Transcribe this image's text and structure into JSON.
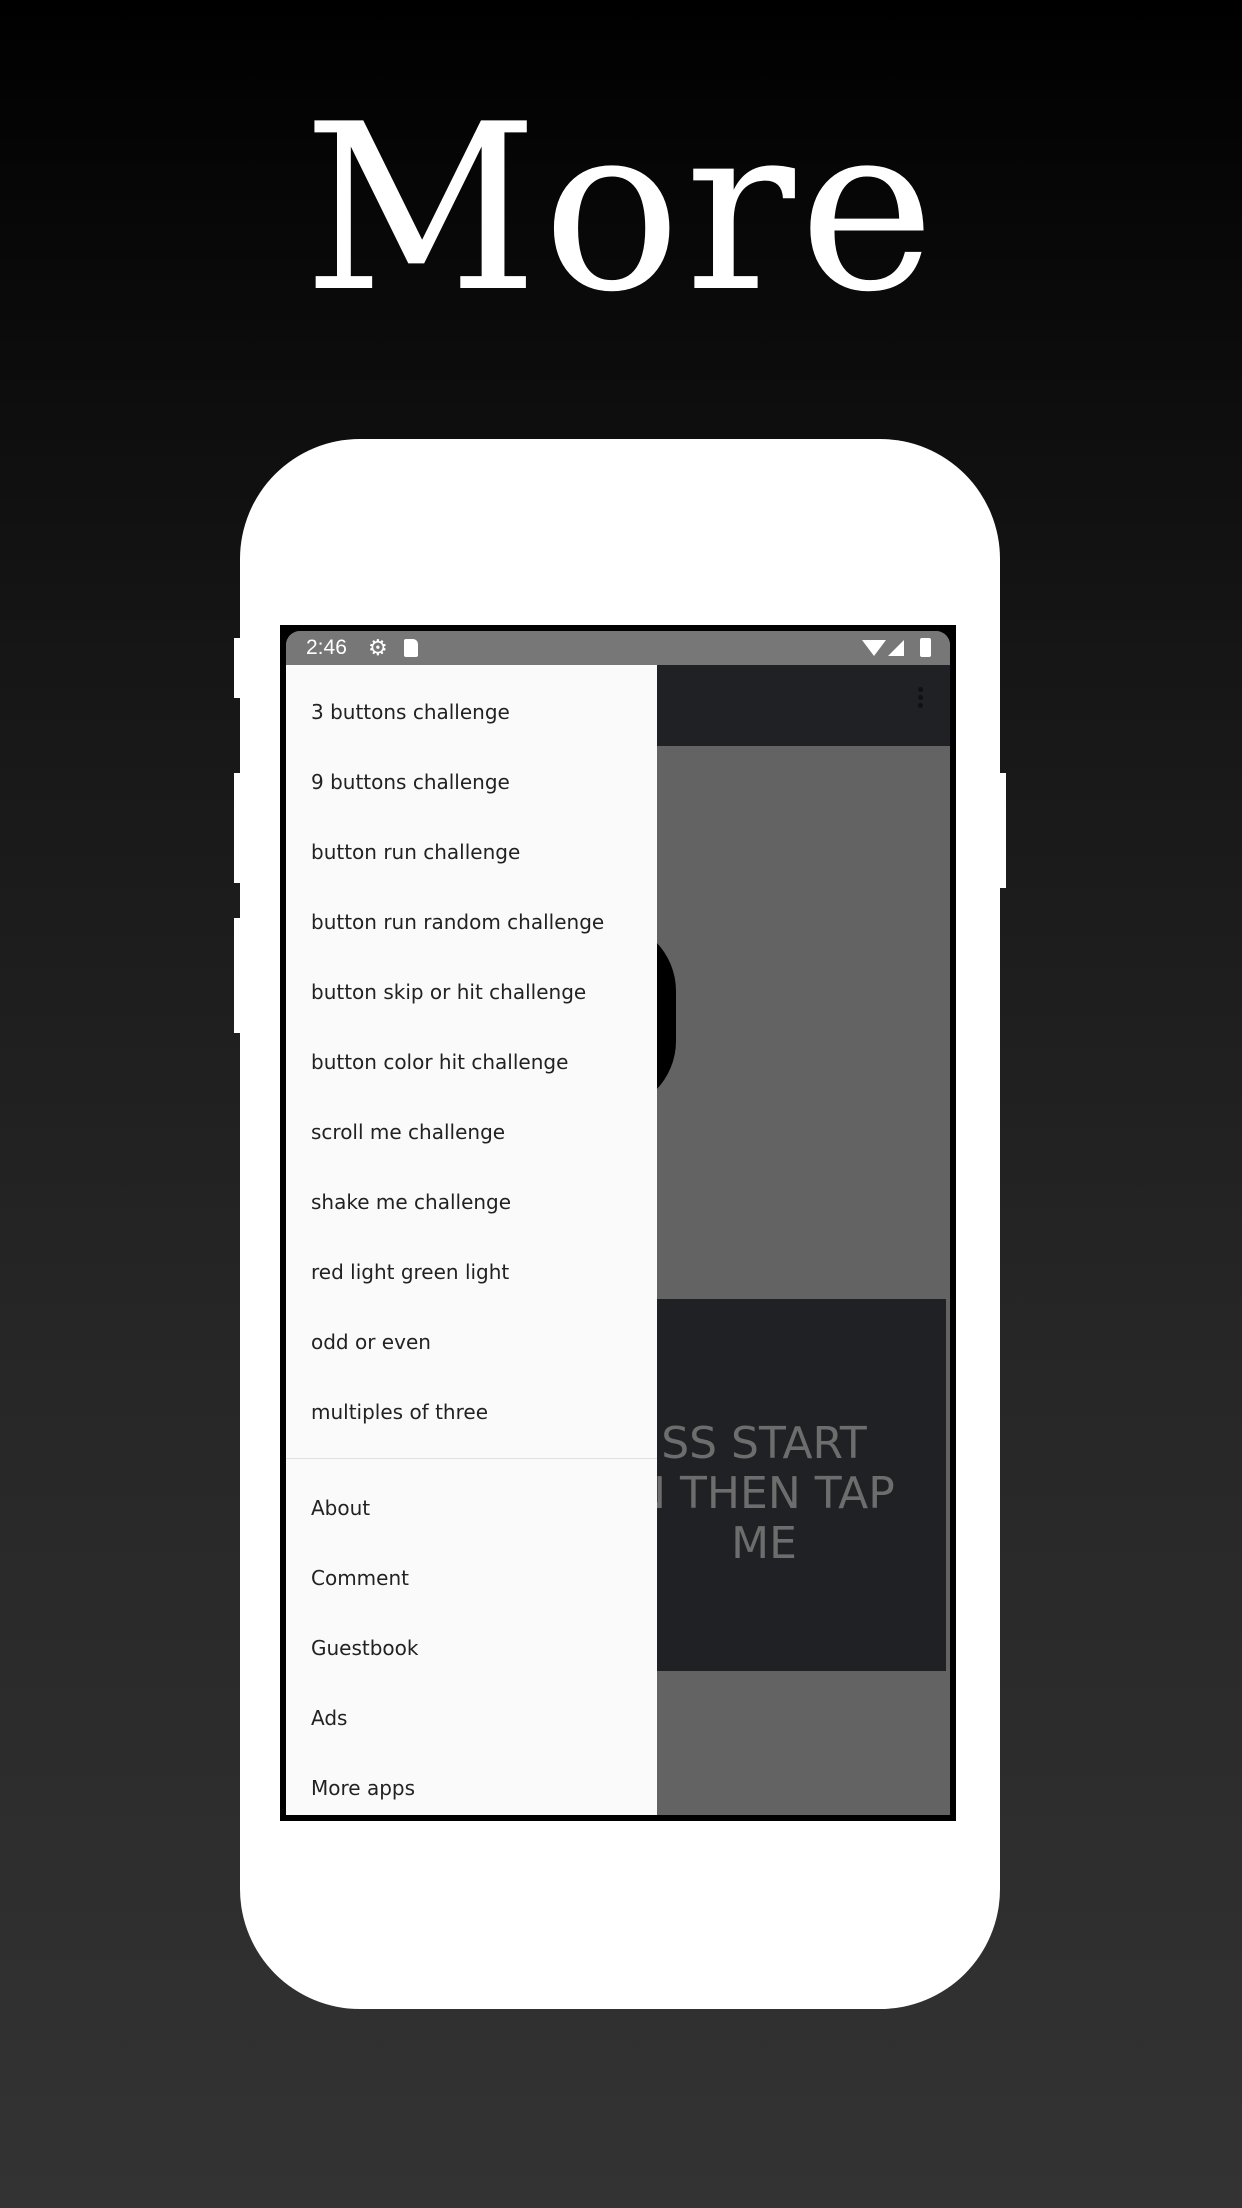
{
  "headline": "More",
  "status_bar": {
    "time": "2:46",
    "icons": [
      "gear-icon",
      "sd-card-icon",
      "wifi-icon",
      "signal-icon",
      "battery-icon"
    ]
  },
  "app_bar": {
    "overflow_icon": "more-vert-icon"
  },
  "background_content": {
    "lines": [
      "PRESS START",
      "BUTTON THEN TAP",
      "ME"
    ],
    "visible_lines": [
      "SS START",
      "N THEN TAP",
      "ME"
    ]
  },
  "drawer": {
    "challenges": [
      {
        "label": "3 buttons challenge"
      },
      {
        "label": "9 buttons challenge"
      },
      {
        "label": "button run challenge"
      },
      {
        "label": "button run random challenge"
      },
      {
        "label": "button skip or hit challenge"
      },
      {
        "label": "button color hit challenge"
      },
      {
        "label": "scroll me challenge"
      },
      {
        "label": "shake me challenge"
      },
      {
        "label": "red light green light"
      },
      {
        "label": "odd or even"
      },
      {
        "label": "multiples of three"
      }
    ],
    "more": [
      {
        "label": "About"
      },
      {
        "label": "Comment"
      },
      {
        "label": "Guestbook"
      },
      {
        "label": "Ads"
      },
      {
        "label": "More apps"
      }
    ]
  },
  "colors": {
    "drawer_bg": "#fafafa",
    "status_bar": "#777777",
    "app_bar": "#202124",
    "scrim_content": "#636363"
  }
}
